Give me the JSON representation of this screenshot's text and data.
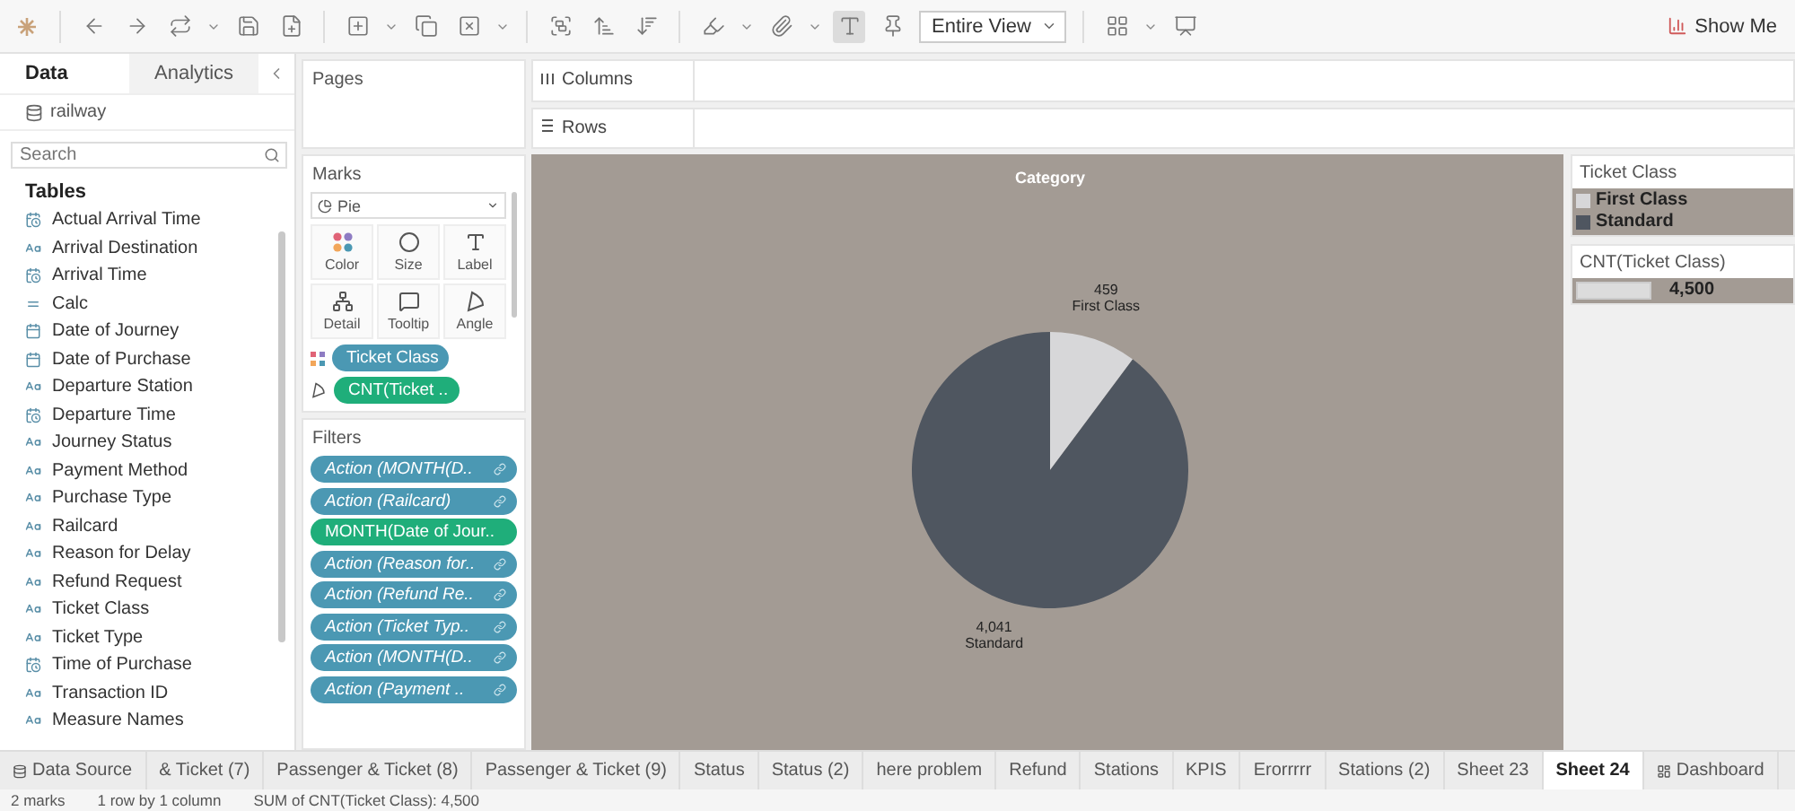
{
  "toolbar": {
    "view_dropdown": "Entire View",
    "show_me": "Show Me",
    "mark_labels_on": true
  },
  "data_pane": {
    "tabs": [
      {
        "label": "Data",
        "selected": true
      },
      {
        "label": "Analytics",
        "selected": false
      }
    ],
    "datasource": "railway",
    "search": {
      "placeholder": "Search"
    },
    "tables_heading": "Tables",
    "fields": [
      {
        "name": "Actual Arrival Time",
        "kind": "datetime"
      },
      {
        "name": "Arrival Destination",
        "kind": "string"
      },
      {
        "name": "Arrival Time",
        "kind": "datetime"
      },
      {
        "name": "Calc",
        "kind": "calc"
      },
      {
        "name": "Date of Journey",
        "kind": "date"
      },
      {
        "name": "Date of Purchase",
        "kind": "date"
      },
      {
        "name": "Departure Station",
        "kind": "string"
      },
      {
        "name": "Departure Time",
        "kind": "datetime"
      },
      {
        "name": "Journey Status",
        "kind": "string"
      },
      {
        "name": "Payment Method",
        "kind": "string"
      },
      {
        "name": "Purchase Type",
        "kind": "string"
      },
      {
        "name": "Railcard",
        "kind": "string"
      },
      {
        "name": "Reason for Delay",
        "kind": "string"
      },
      {
        "name": "Refund Request",
        "kind": "string"
      },
      {
        "name": "Ticket Class",
        "kind": "string"
      },
      {
        "name": "Ticket Type",
        "kind": "string"
      },
      {
        "name": "Time of Purchase",
        "kind": "datetime"
      },
      {
        "name": "Transaction ID",
        "kind": "string"
      },
      {
        "name": "Measure Names",
        "kind": "string"
      }
    ]
  },
  "pages": {
    "title": "Pages"
  },
  "shelves": [
    {
      "label": "Columns",
      "kind": "columns"
    },
    {
      "label": "Rows",
      "kind": "rows"
    }
  ],
  "marks": {
    "title": "Marks",
    "mark_type": "Pie",
    "buttons": [
      {
        "label": "Color",
        "kind": "color"
      },
      {
        "label": "Size",
        "kind": "size"
      },
      {
        "label": "Label",
        "kind": "label"
      },
      {
        "label": "Detail",
        "kind": "detail"
      },
      {
        "label": "Tooltip",
        "kind": "tooltip"
      },
      {
        "label": "Angle",
        "kind": "angle"
      }
    ],
    "pills": [
      {
        "label": "Ticket Class",
        "kind": "color"
      },
      {
        "label": "CNT(Ticket ..",
        "kind": "angle"
      }
    ]
  },
  "filters": {
    "title": "Filters",
    "pills": [
      {
        "label": "Action (MONTH(D..",
        "kind": "action"
      },
      {
        "label": "Action (Railcard)",
        "kind": "action"
      },
      {
        "label": "MONTH(Date of Jour..",
        "kind": "continuous"
      },
      {
        "label": "Action (Reason for..",
        "kind": "action"
      },
      {
        "label": "Action (Refund Re..",
        "kind": "action"
      },
      {
        "label": "Action (Ticket Typ..",
        "kind": "action"
      },
      {
        "label": "Action (MONTH(D..",
        "kind": "action"
      },
      {
        "label": "Action (Payment ..",
        "kind": "action"
      }
    ]
  },
  "view": {
    "chart_data": {
      "type": "pie",
      "title": "Category",
      "categories": [
        "First Class",
        "Standard"
      ],
      "values": [
        459,
        4041
      ],
      "value_labels": [
        "459",
        "4,041"
      ],
      "data_labels": true
    }
  },
  "legend": {
    "title": "Ticket Class",
    "items": [
      {
        "label": "First Class",
        "color": "#d7d7d9"
      },
      {
        "label": "Standard",
        "color": "#4f5660"
      }
    ]
  },
  "size_legend": {
    "title": "CNT(Ticket Class)",
    "value": "4,500"
  },
  "sheet_tabs": [
    {
      "label": "Data Source",
      "kind": "source",
      "selected": false
    },
    {
      "label": "& Ticket (7)",
      "kind": "sheet",
      "selected": false
    },
    {
      "label": "Passenger & Ticket (8)",
      "kind": "sheet",
      "selected": false
    },
    {
      "label": "Passenger & Ticket (9)",
      "kind": "sheet",
      "selected": false
    },
    {
      "label": "Status",
      "kind": "sheet",
      "selected": false
    },
    {
      "label": "Status (2)",
      "kind": "sheet",
      "selected": false
    },
    {
      "label": "here problem",
      "kind": "sheet",
      "selected": false
    },
    {
      "label": "Refund",
      "kind": "sheet",
      "selected": false
    },
    {
      "label": "Stations",
      "kind": "sheet",
      "selected": false
    },
    {
      "label": "KPIS",
      "kind": "sheet",
      "selected": false
    },
    {
      "label": "Erorrrrr",
      "kind": "sheet",
      "selected": false
    },
    {
      "label": "Stations (2)",
      "kind": "sheet",
      "selected": false
    },
    {
      "label": "Sheet 23",
      "kind": "sheet",
      "selected": false
    },
    {
      "label": "Sheet 24",
      "kind": "sheet",
      "selected": true
    },
    {
      "label": "Dashboard",
      "kind": "dashboard",
      "selected": false
    }
  ],
  "status_bar": [
    "2 marks",
    "1 row by 1 column",
    "SUM of CNT(Ticket Class): 4,500"
  ]
}
